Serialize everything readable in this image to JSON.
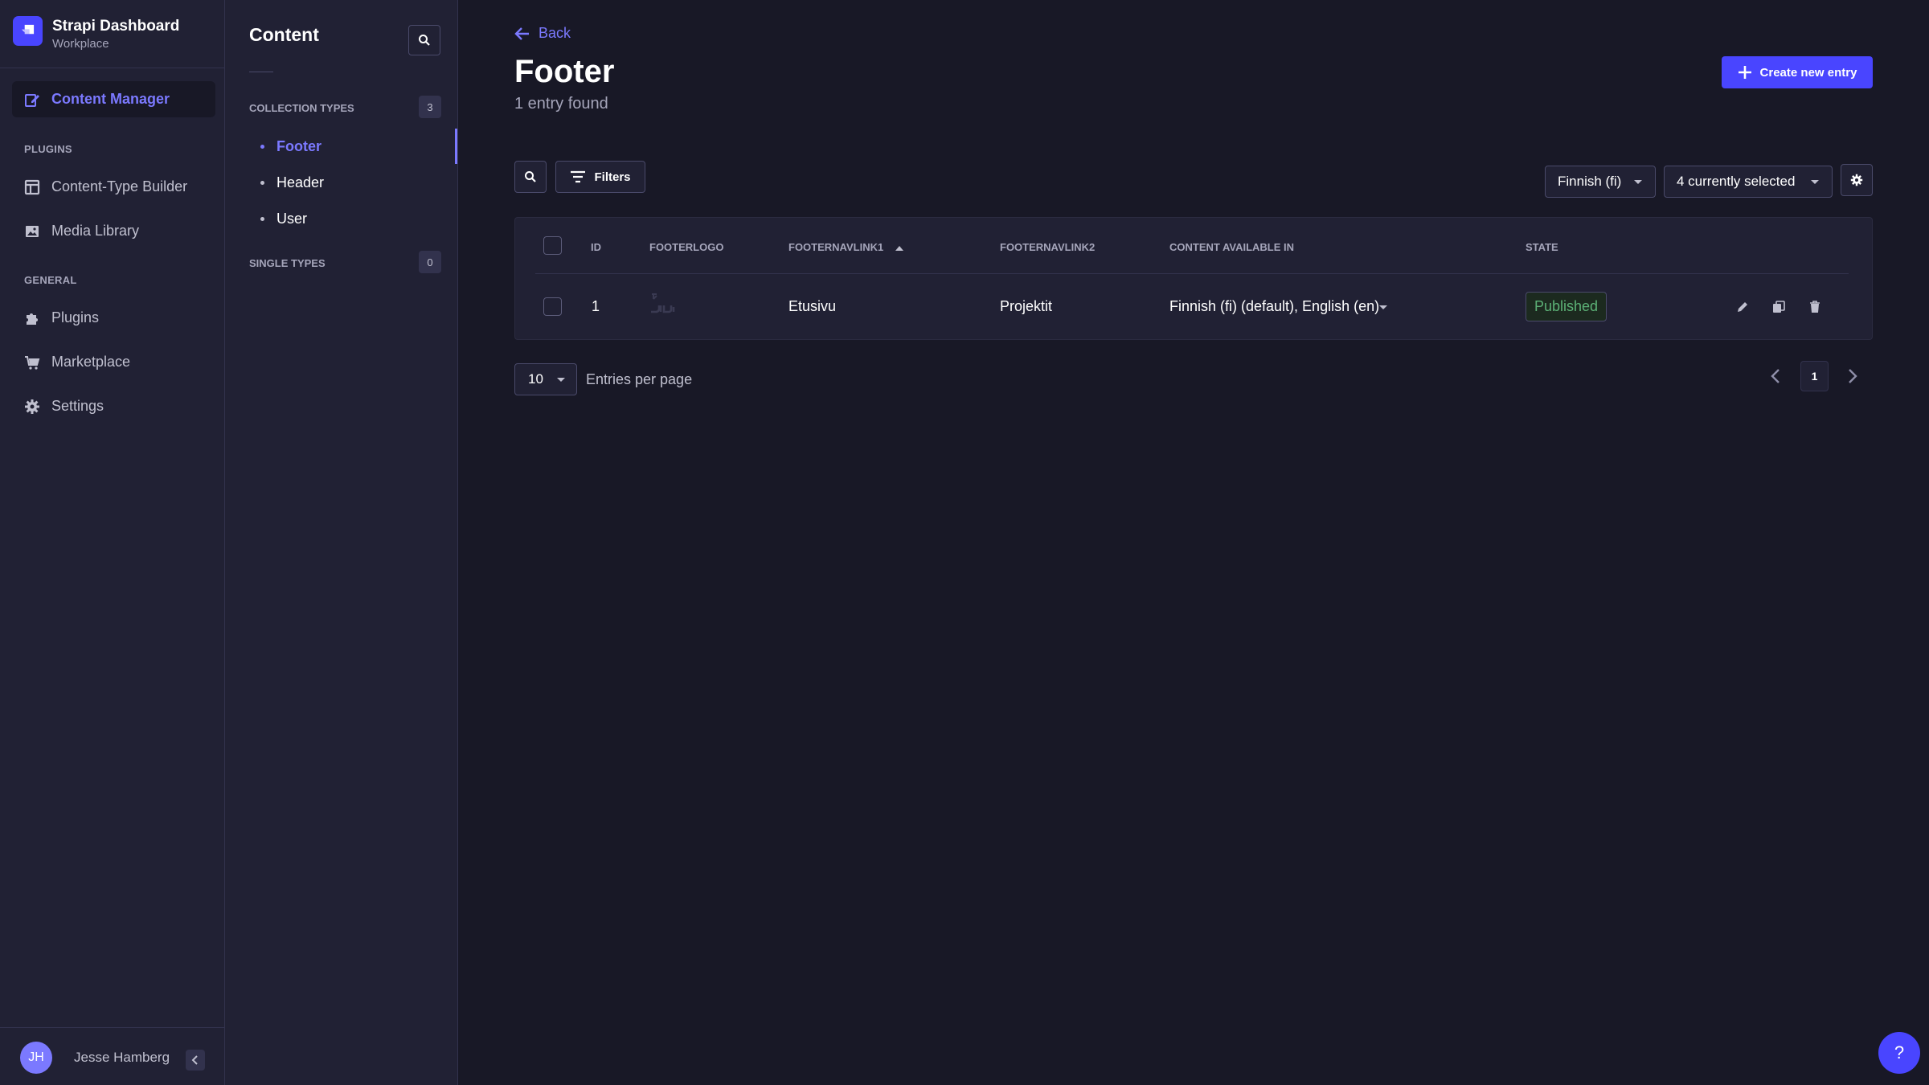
{
  "brand": {
    "title": "Strapi Dashboard",
    "subtitle": "Workplace"
  },
  "mainnav": {
    "content_manager": "Content Manager",
    "plugins_section": "PLUGINS",
    "content_type_builder": "Content-Type Builder",
    "media_library": "Media Library",
    "general_section": "GENERAL",
    "plugins": "Plugins",
    "marketplace": "Marketplace",
    "settings": "Settings"
  },
  "user": {
    "initials": "JH",
    "name": "Jesse Hamberg"
  },
  "subnav": {
    "title": "Content",
    "collection_types_label": "COLLECTION TYPES",
    "collection_types_count": "3",
    "collection_types": [
      "Footer",
      "Header",
      "User"
    ],
    "single_types_label": "SINGLE TYPES",
    "single_types_count": "0"
  },
  "header": {
    "back_label": "Back",
    "title": "Footer",
    "subtitle": "1 entry found",
    "create_label": "Create new entry"
  },
  "toolbar": {
    "filters_label": "Filters",
    "locale_select": "Finnish (fi)",
    "columns_select": "4 currently selected"
  },
  "table": {
    "headers": [
      "ID",
      "FOOTERLOGO",
      "FOOTERNAVLINK1",
      "FOOTERNAVLINK2",
      "CONTENT AVAILABLE IN",
      "STATE"
    ],
    "rows": [
      {
        "id": "1",
        "footernavlink1": "Etusivu",
        "footernavlink2": "Projektit",
        "locales": "Finnish (fi) (default), English (en)",
        "state": "Published"
      }
    ]
  },
  "pagination": {
    "page_size": "10",
    "page_size_label": "Entries per page",
    "current_page": "1"
  },
  "help": {
    "label": "?"
  },
  "colors": {
    "primary": "#4945ff",
    "accent": "#7b79ff",
    "success": "#5cb176",
    "background": "#181826",
    "surface": "#212134"
  }
}
